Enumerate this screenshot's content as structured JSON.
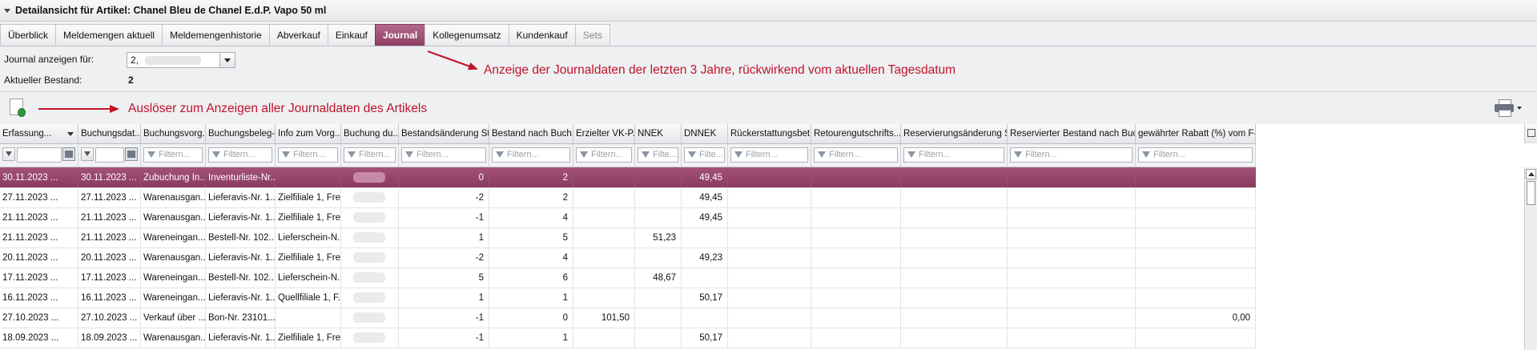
{
  "title": "Detailansicht für Artikel: Chanel Bleu de Chanel E.d.P. Vapo 50 ml",
  "tabs": [
    "Überblick",
    "Meldemengen aktuell",
    "Meldemengenhistorie",
    "Abverkauf",
    "Einkauf",
    "Journal",
    "Kollegenumsatz",
    "Kundenkauf",
    "Sets"
  ],
  "active_tab": "Journal",
  "form": {
    "journal_label": "Journal anzeigen für:",
    "journal_value": "2,",
    "bestand_label": "Aktueller Bestand:",
    "bestand_value": "2"
  },
  "annotations": {
    "tab_note": "Anzeige der Journaldaten der letzten 3 Jahre, rückwirkend vom  aktuellen Tagesdatum",
    "button_note": "Auslöser zum Anzeigen aller Journaldaten des Artikels"
  },
  "grid": {
    "columns": [
      "Erfassung...",
      "Buchungsdat...",
      "Buchungsvorg...",
      "Buchungsbeleg-...",
      "Info zum Vorg...",
      "Buchung du...",
      "Bestandsänderung St...",
      "Bestand nach Buch...",
      "Erzielter VK-P...",
      "NNEK",
      "DNNEK",
      "Rückerstattungsbet...",
      "Retourengutschrifts...",
      "Reservierungsänderung St...",
      "Reservierter Bestand nach Buch...",
      "gewährter Rabatt (%) vom F-..."
    ],
    "filter_placeholder": "Filtern...",
    "filter_placeholder_short": "Filte...",
    "rows": [
      [
        "30.11.2023 ...",
        "30.11.2023 ...",
        "Zubuchung In...",
        "Inventurliste-Nr...",
        "",
        "",
        "0",
        "2",
        "",
        "",
        "49,45",
        "",
        "",
        "",
        "",
        ""
      ],
      [
        "27.11.2023 ...",
        "27.11.2023 ...",
        "Warenausgan...",
        "Lieferavis-Nr. 1...",
        "Zielfiliale 1, Fre...",
        "",
        "-2",
        "2",
        "",
        "",
        "49,45",
        "",
        "",
        "",
        "",
        ""
      ],
      [
        "21.11.2023 ...",
        "21.11.2023 ...",
        "Warenausgan...",
        "Lieferavis-Nr. 1...",
        "Zielfiliale 1, Fre...",
        "",
        "-1",
        "4",
        "",
        "",
        "49,45",
        "",
        "",
        "",
        "",
        ""
      ],
      [
        "21.11.2023 ...",
        "21.11.2023 ...",
        "Wareneingan...",
        "Bestell-Nr. 102...",
        "Lieferschein-N...",
        "",
        "1",
        "5",
        "",
        "51,23",
        "",
        "",
        "",
        "",
        "",
        ""
      ],
      [
        "20.11.2023 ...",
        "20.11.2023 ...",
        "Warenausgan...",
        "Lieferavis-Nr. 1...",
        "Zielfiliale 1, Fre...",
        "",
        "-2",
        "4",
        "",
        "",
        "49,23",
        "",
        "",
        "",
        "",
        ""
      ],
      [
        "17.11.2023 ...",
        "17.11.2023 ...",
        "Wareneingan...",
        "Bestell-Nr. 102...",
        "Lieferschein-N...",
        "",
        "5",
        "6",
        "",
        "48,67",
        "",
        "",
        "",
        "",
        "",
        ""
      ],
      [
        "16.11.2023 ...",
        "16.11.2023 ...",
        "Wareneingan...",
        "Lieferavis-Nr. 1...",
        "Quellfiliale 1, F...",
        "",
        "1",
        "1",
        "",
        "",
        "50,17",
        "",
        "",
        "",
        "",
        ""
      ],
      [
        "27.10.2023 ...",
        "27.10.2023 ...",
        "Verkauf über ...",
        "Bon-Nr. 23101...",
        "",
        "",
        "-1",
        "0",
        "101,50",
        "",
        "",
        "",
        "",
        "",
        "",
        "0,00"
      ],
      [
        "18.09.2023 ...",
        "18.09.2023 ...",
        "Warenausgan...",
        "Lieferavis-Nr. 1...",
        "Zielfiliale 1, Fre...",
        "",
        "-1",
        "1",
        "",
        "",
        "50,17",
        "",
        "",
        "",
        "",
        ""
      ]
    ]
  }
}
